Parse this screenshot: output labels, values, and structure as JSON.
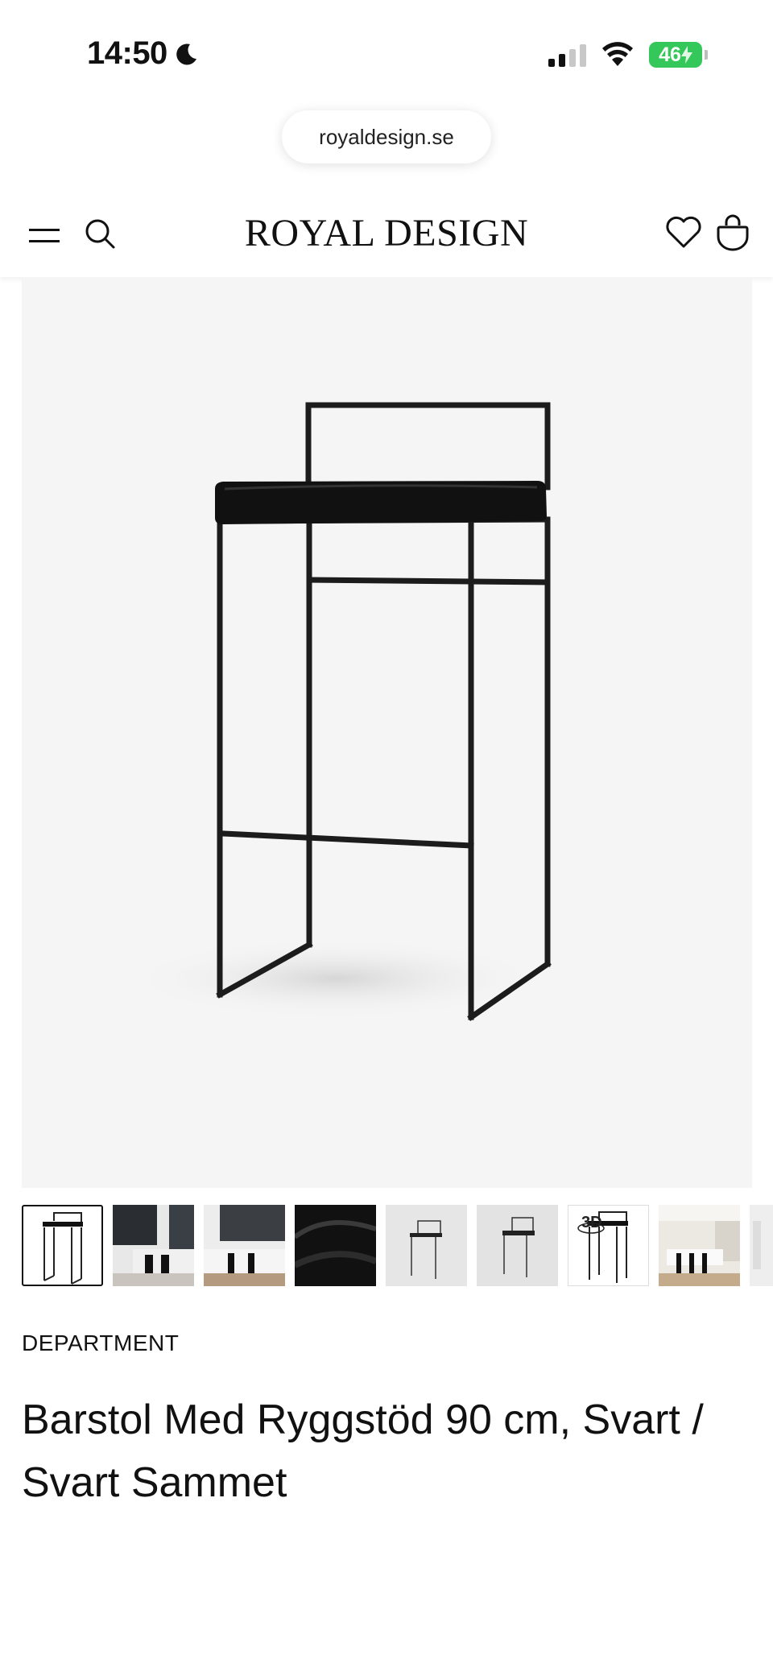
{
  "status_bar": {
    "time": "14:50",
    "battery": "46"
  },
  "browser": {
    "url": "royaldesign.se"
  },
  "header": {
    "brand": "ROYAL DESIGN"
  },
  "product": {
    "brand_label": "DEPARTMENT",
    "title": "Barstol Med Ryggstöd 90 cm, Svart / Svart Sammet",
    "thumbnails": [
      {
        "kind": "chair-front",
        "active": true
      },
      {
        "kind": "dark-kitchen"
      },
      {
        "kind": "kitchen-island"
      },
      {
        "kind": "velvet-fabric"
      },
      {
        "kind": "chair-grey"
      },
      {
        "kind": "chair-grey-angle"
      },
      {
        "kind": "chair-3d",
        "label": "3D"
      },
      {
        "kind": "kitchen-room"
      },
      {
        "kind": "chair-partial"
      }
    ]
  }
}
